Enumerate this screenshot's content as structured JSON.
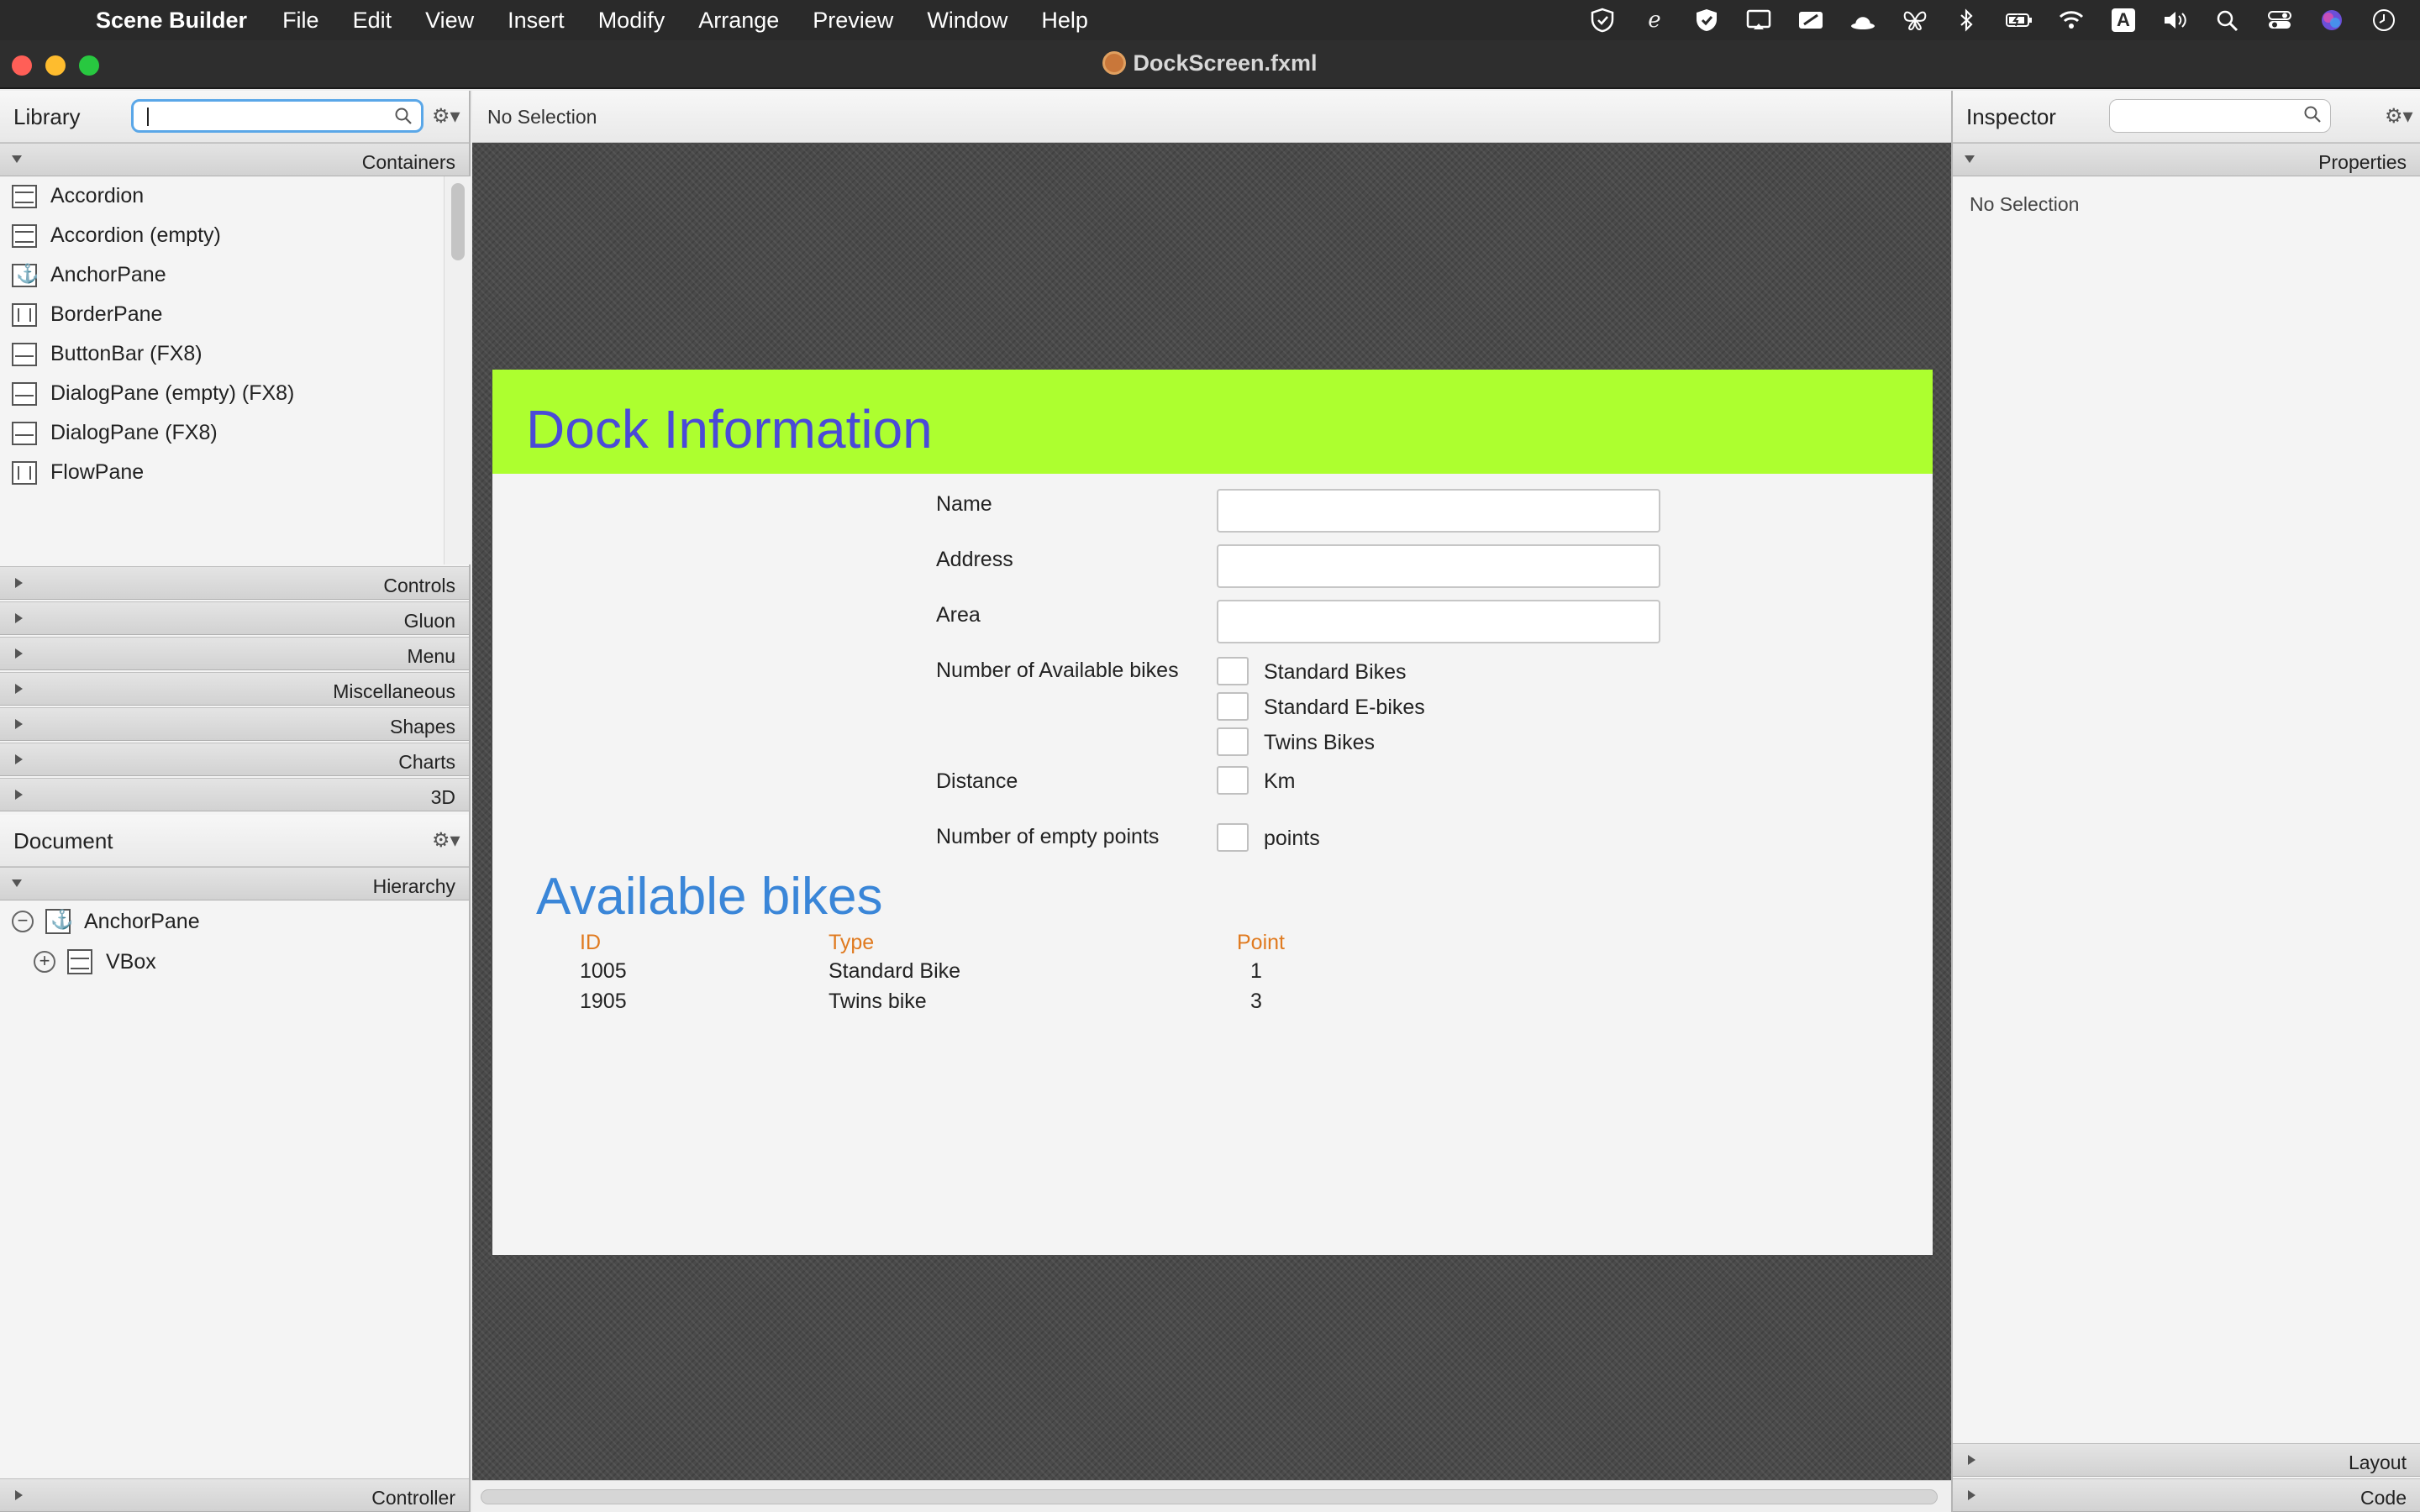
{
  "menubar": {
    "app_name": "Scene Builder",
    "items": [
      "File",
      "Edit",
      "View",
      "Insert",
      "Modify",
      "Arrange",
      "Preview",
      "Window",
      "Help"
    ],
    "tray_icons": [
      "vpn-shield-icon",
      "script-e-icon",
      "shield-check-icon",
      "screen-mirror-icon",
      "pen-tablet-icon",
      "hat-icon",
      "butterfly-icon",
      "bluetooth-icon",
      "battery-icon",
      "wifi-icon",
      "input-source-icon",
      "volume-icon",
      "spotlight-search-icon",
      "control-center-icon",
      "siri-icon",
      "clock-icon"
    ],
    "input_source": "A"
  },
  "window": {
    "title": "DockScreen.fxml"
  },
  "library": {
    "title": "Library",
    "search_value": "",
    "sections": {
      "containers": "Containers",
      "controls": "Controls",
      "gluon": "Gluon",
      "menu": "Menu",
      "misc": "Miscellaneous",
      "shapes": "Shapes",
      "charts": "Charts",
      "three_d": "3D"
    },
    "items": [
      "Accordion",
      "Accordion  (empty)",
      "AnchorPane",
      "BorderPane",
      "ButtonBar  (FX8)",
      "DialogPane (empty)  (FX8)",
      "DialogPane  (FX8)",
      "FlowPane"
    ]
  },
  "document": {
    "title": "Document",
    "hierarchy_label": "Hierarchy",
    "tree": [
      {
        "label": "AnchorPane",
        "toggle": "−"
      },
      {
        "label": "VBox",
        "toggle": "+"
      }
    ],
    "controller_label": "Controller"
  },
  "center": {
    "selection_label": "No Selection"
  },
  "design": {
    "header_title": "Dock Information",
    "labels": {
      "name": "Name",
      "address": "Address",
      "area": "Area",
      "available": "Number of Available bikes",
      "distance": "Distance",
      "empty_points": "Number of empty points"
    },
    "checks": {
      "standard": "Standard Bikes",
      "ebikes": "Standard E-bikes",
      "twins": "Twins Bikes",
      "km": "Km",
      "points": "points"
    },
    "available_title": "Available bikes",
    "table": {
      "headers": [
        "ID",
        "Type",
        "Point"
      ],
      "rows": [
        [
          "1005",
          "Standard Bike",
          "1"
        ],
        [
          "1905",
          "Twins bike",
          "3"
        ]
      ]
    },
    "colors": {
      "header_bg": "#adff2f",
      "header_text": "#4a4ad8",
      "avail_title": "#3a86d8",
      "table_header": "#e07a1f"
    }
  },
  "inspector": {
    "title": "Inspector",
    "search_value": "",
    "properties_label": "Properties",
    "no_selection": "No Selection",
    "layout_label": "Layout",
    "code_label": "Code"
  }
}
